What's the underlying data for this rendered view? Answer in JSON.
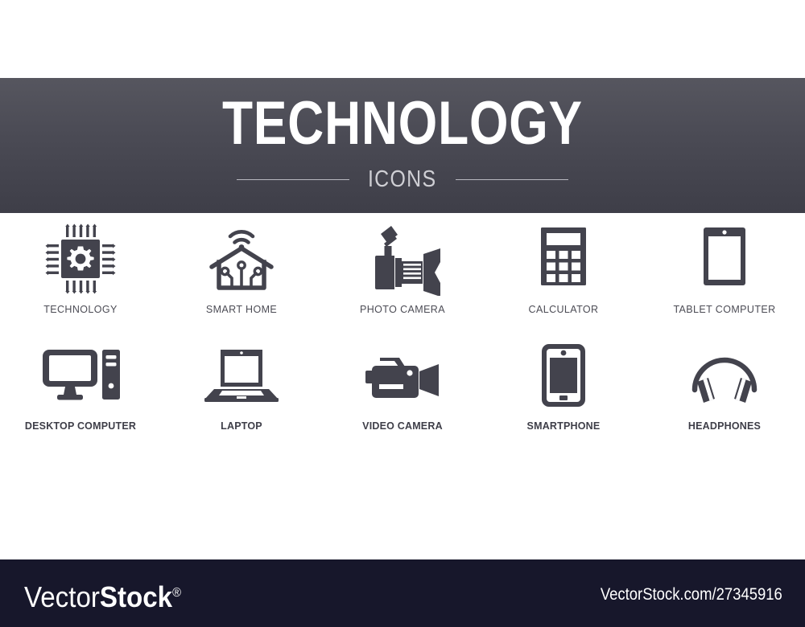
{
  "banner": {
    "title": "TECHNOLOGY",
    "subtitle": "ICONS"
  },
  "colors": {
    "icon_dark": "#43434d",
    "banner_top": "#56565f",
    "banner_bottom": "#3e3e48",
    "footer_bg": "#17172b",
    "label_row1": "#4c4c55",
    "label_row2": "#3e3e48",
    "page_bg": "#ffffff"
  },
  "grid": {
    "rows": [
      {
        "cells": [
          {
            "label": "TECHNOLOGY",
            "icon": "microchip-gear-icon"
          },
          {
            "label": "SMART HOME",
            "icon": "smart-home-wifi-icon"
          },
          {
            "label": "PHOTO CAMERA",
            "icon": "photo-camera-icon"
          },
          {
            "label": "CALCULATOR",
            "icon": "calculator-icon"
          },
          {
            "label": "TABLET COMPUTER",
            "icon": "tablet-computer-icon"
          }
        ]
      },
      {
        "cells": [
          {
            "label": "DESKTOP COMPUTER",
            "icon": "desktop-computer-icon"
          },
          {
            "label": "LAPTOP",
            "icon": "laptop-icon"
          },
          {
            "label": "VIDEO CAMERA",
            "icon": "video-camera-icon"
          },
          {
            "label": "SMARTPHONE",
            "icon": "smartphone-icon"
          },
          {
            "label": "HEADPHONES",
            "icon": "headphones-icon"
          }
        ]
      }
    ]
  },
  "footer": {
    "logo_part1": "Vector",
    "logo_part2": "Stock",
    "logo_mark": "®",
    "url": "VectorStock.com/27345916"
  }
}
